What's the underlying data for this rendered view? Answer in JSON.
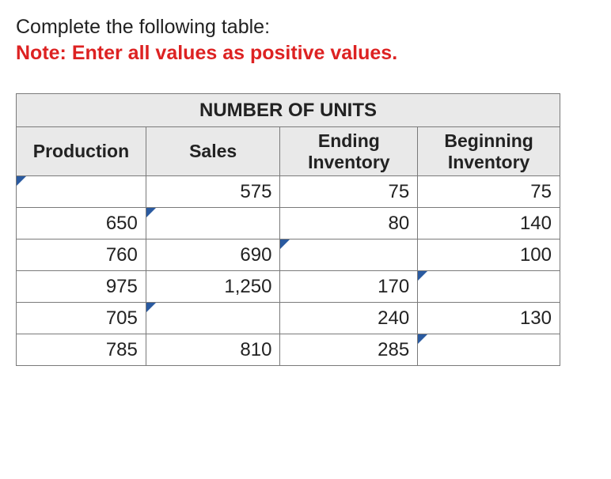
{
  "instruction": "Complete the following table:",
  "note": "Note: Enter all values as positive values.",
  "table": {
    "top_header": "NUMBER OF UNITS",
    "columns": [
      "Production",
      "Sales",
      "Ending Inventory",
      "Beginning Inventory"
    ],
    "rows": [
      {
        "production": "",
        "sales": "575",
        "ending": "75",
        "beginning": "75",
        "inputs": {
          "production": true,
          "sales": false,
          "ending": false,
          "beginning": false
        }
      },
      {
        "production": "650",
        "sales": "",
        "ending": "80",
        "beginning": "140",
        "inputs": {
          "production": false,
          "sales": true,
          "ending": false,
          "beginning": false
        }
      },
      {
        "production": "760",
        "sales": "690",
        "ending": "",
        "beginning": "100",
        "inputs": {
          "production": false,
          "sales": false,
          "ending": true,
          "beginning": false
        }
      },
      {
        "production": "975",
        "sales": "1,250",
        "ending": "170",
        "beginning": "",
        "inputs": {
          "production": false,
          "sales": false,
          "ending": false,
          "beginning": true
        }
      },
      {
        "production": "705",
        "sales": "",
        "ending": "240",
        "beginning": "130",
        "inputs": {
          "production": false,
          "sales": true,
          "ending": false,
          "beginning": false
        }
      },
      {
        "production": "785",
        "sales": "810",
        "ending": "285",
        "beginning": "",
        "inputs": {
          "production": false,
          "sales": false,
          "ending": false,
          "beginning": true
        }
      }
    ]
  }
}
